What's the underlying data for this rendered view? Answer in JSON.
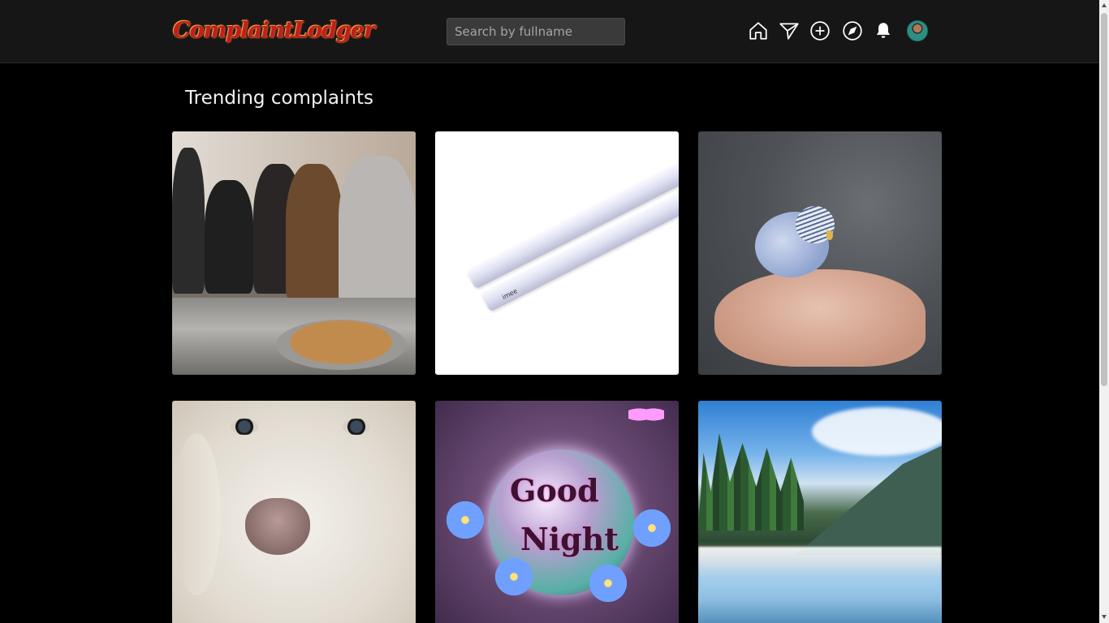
{
  "app": {
    "logo_text": "ComplaintLodger"
  },
  "search": {
    "placeholder": "Search by fullname",
    "value": ""
  },
  "nav": {
    "icons": [
      "home-icon",
      "send-icon",
      "add-circle-icon",
      "explore-compass-icon",
      "notifications-bell-icon"
    ],
    "avatar": "user-avatar"
  },
  "main": {
    "heading": "Trending complaints",
    "cards": [
      {
        "image": "canteen-food-serving-photo"
      },
      {
        "image": "led-tube-light-photo"
      },
      {
        "image": "budgie-bird-on-hand-photo"
      },
      {
        "image": "white-dog-closeup-photo"
      },
      {
        "image": "good-night-greeting-image",
        "text_line1": "Good",
        "text_line2": "Night"
      },
      {
        "image": "waterfall-landscape-photo"
      }
    ]
  },
  "colors": {
    "background": "#000000",
    "topbar": "#161616",
    "logo": "#c0201a",
    "search_bg": "#3a3a3a"
  }
}
